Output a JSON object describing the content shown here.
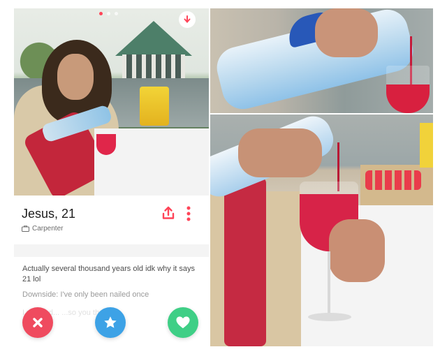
{
  "profile": {
    "name_age": "Jesus, 21",
    "occupation": "Carpenter",
    "bio": "Actually several thousand years old idk why it says 21 lol",
    "downside": "Downside: I've only been nailed once",
    "faded_text": "I would d...        ...so you th..."
  },
  "photos": {
    "total": 3,
    "active_index": 0
  },
  "colors": {
    "nope": "#ef4b5f",
    "super_like": "#3da2e6",
    "like": "#3fcf86",
    "accent": "#ff4458"
  },
  "icons": {
    "info": "arrow-down-icon",
    "share": "share-icon",
    "more": "more-vertical-icon",
    "occupation": "briefcase-icon",
    "nope": "close-icon",
    "super_like": "star-icon",
    "like": "heart-icon"
  }
}
